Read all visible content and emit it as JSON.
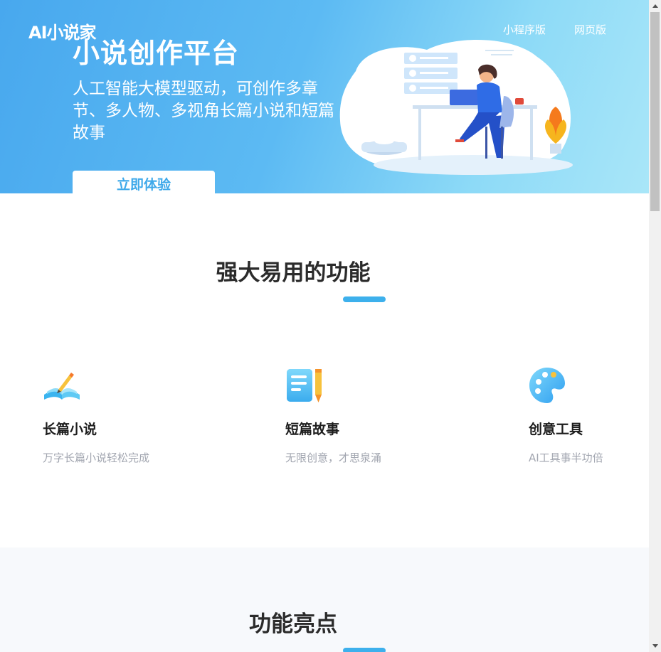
{
  "header": {
    "logo": "AI小说家",
    "nav": [
      "小程序版",
      "网页版"
    ]
  },
  "hero": {
    "title": "小说创作平台",
    "subtitle": "人工智能大模型驱动，可创作多章节、多人物、多视角长篇小说和短篇故事",
    "cta": "立即体验"
  },
  "features": {
    "title": "强大易用的功能",
    "items": [
      {
        "name": "长篇小说",
        "desc": "万字长篇小说轻松完成",
        "icon": "book-pen-icon"
      },
      {
        "name": "短篇故事",
        "desc": "无限创意，才思泉涌",
        "icon": "notepad-pencil-icon"
      },
      {
        "name": "创意工具",
        "desc": "AI工具事半功倍",
        "icon": "palette-icon"
      }
    ]
  },
  "highlights": {
    "title": "功能亮点"
  },
  "colors": {
    "accent": "#3db0ec",
    "hero_start": "#48a8ee",
    "hero_end": "#a9e6f8",
    "desc_text": "#a2a6b0"
  }
}
